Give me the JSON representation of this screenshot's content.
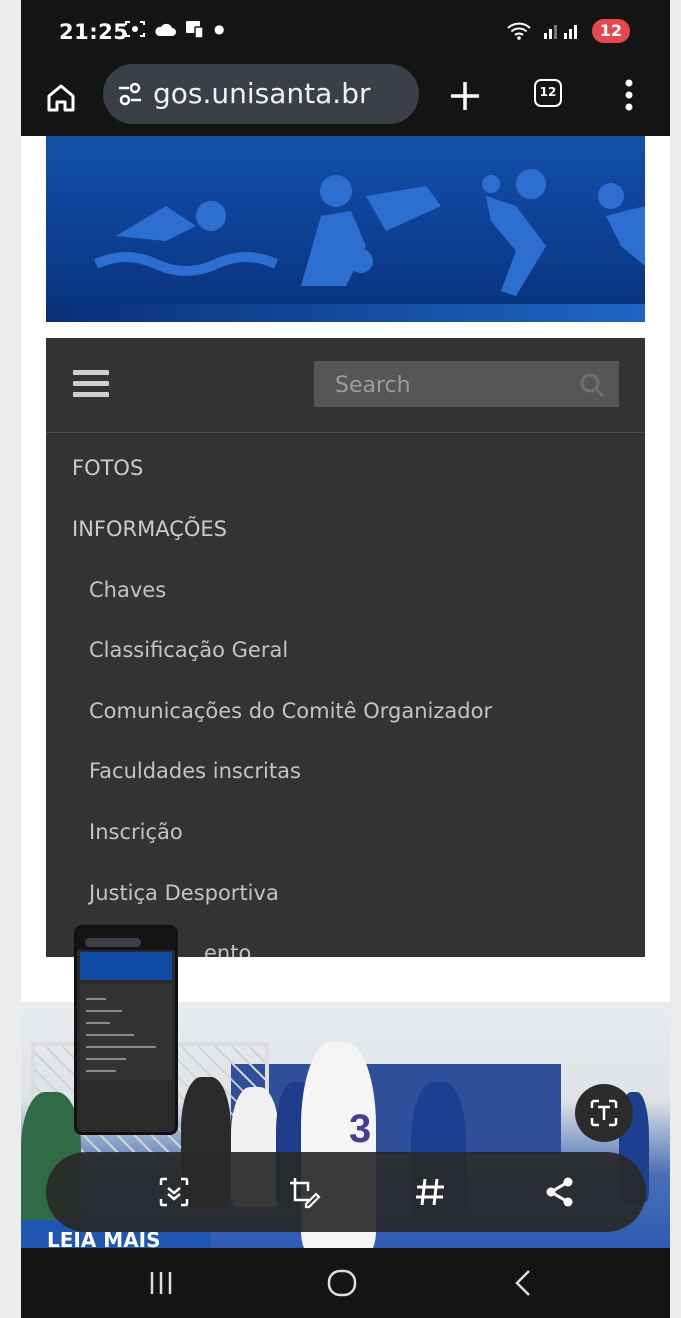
{
  "status_bar": {
    "time": "21:25",
    "battery": "12"
  },
  "browser": {
    "url_display": "gos.unisanta.br",
    "tab_count": "12"
  },
  "search": {
    "placeholder": "Search"
  },
  "menu": {
    "top_items": [
      {
        "label": "FOTOS"
      },
      {
        "label": "INFORMAÇÕES"
      }
    ],
    "sub_items": [
      {
        "label": "Chaves"
      },
      {
        "label": "Classificação Geral"
      },
      {
        "label": "Comunicações do Comitê Organizador"
      },
      {
        "label": "Faculdades inscritas"
      },
      {
        "label": "Inscrição"
      },
      {
        "label": "Justiça Desportiva"
      },
      {
        "label": "ento"
      }
    ]
  },
  "content": {
    "leia_mais": "LEIA MAIS",
    "jersey_number": "3"
  },
  "icons": {
    "home": "home-icon",
    "site_settings": "tune-icon",
    "new_tab": "plus-icon",
    "tab_switcher": "tab-switcher-icon",
    "browser_menu": "more-vert-icon",
    "menu_toggle": "hamburger-icon",
    "search": "search-icon",
    "text_extract": "text-extract-icon",
    "scroll_capture": "scroll-capture-icon",
    "draw_crop": "draw-crop-icon",
    "tag": "hashtag-icon",
    "share": "share-icon",
    "recents": "recents-icon",
    "home_nav": "home-nav-icon",
    "back": "back-icon"
  },
  "colors": {
    "status_bar_bg": "#141414",
    "menu_bg": "#333333",
    "search_bg": "#565656",
    "battery_badge": "#e5484d",
    "brand_blue": "#0d3f93"
  }
}
